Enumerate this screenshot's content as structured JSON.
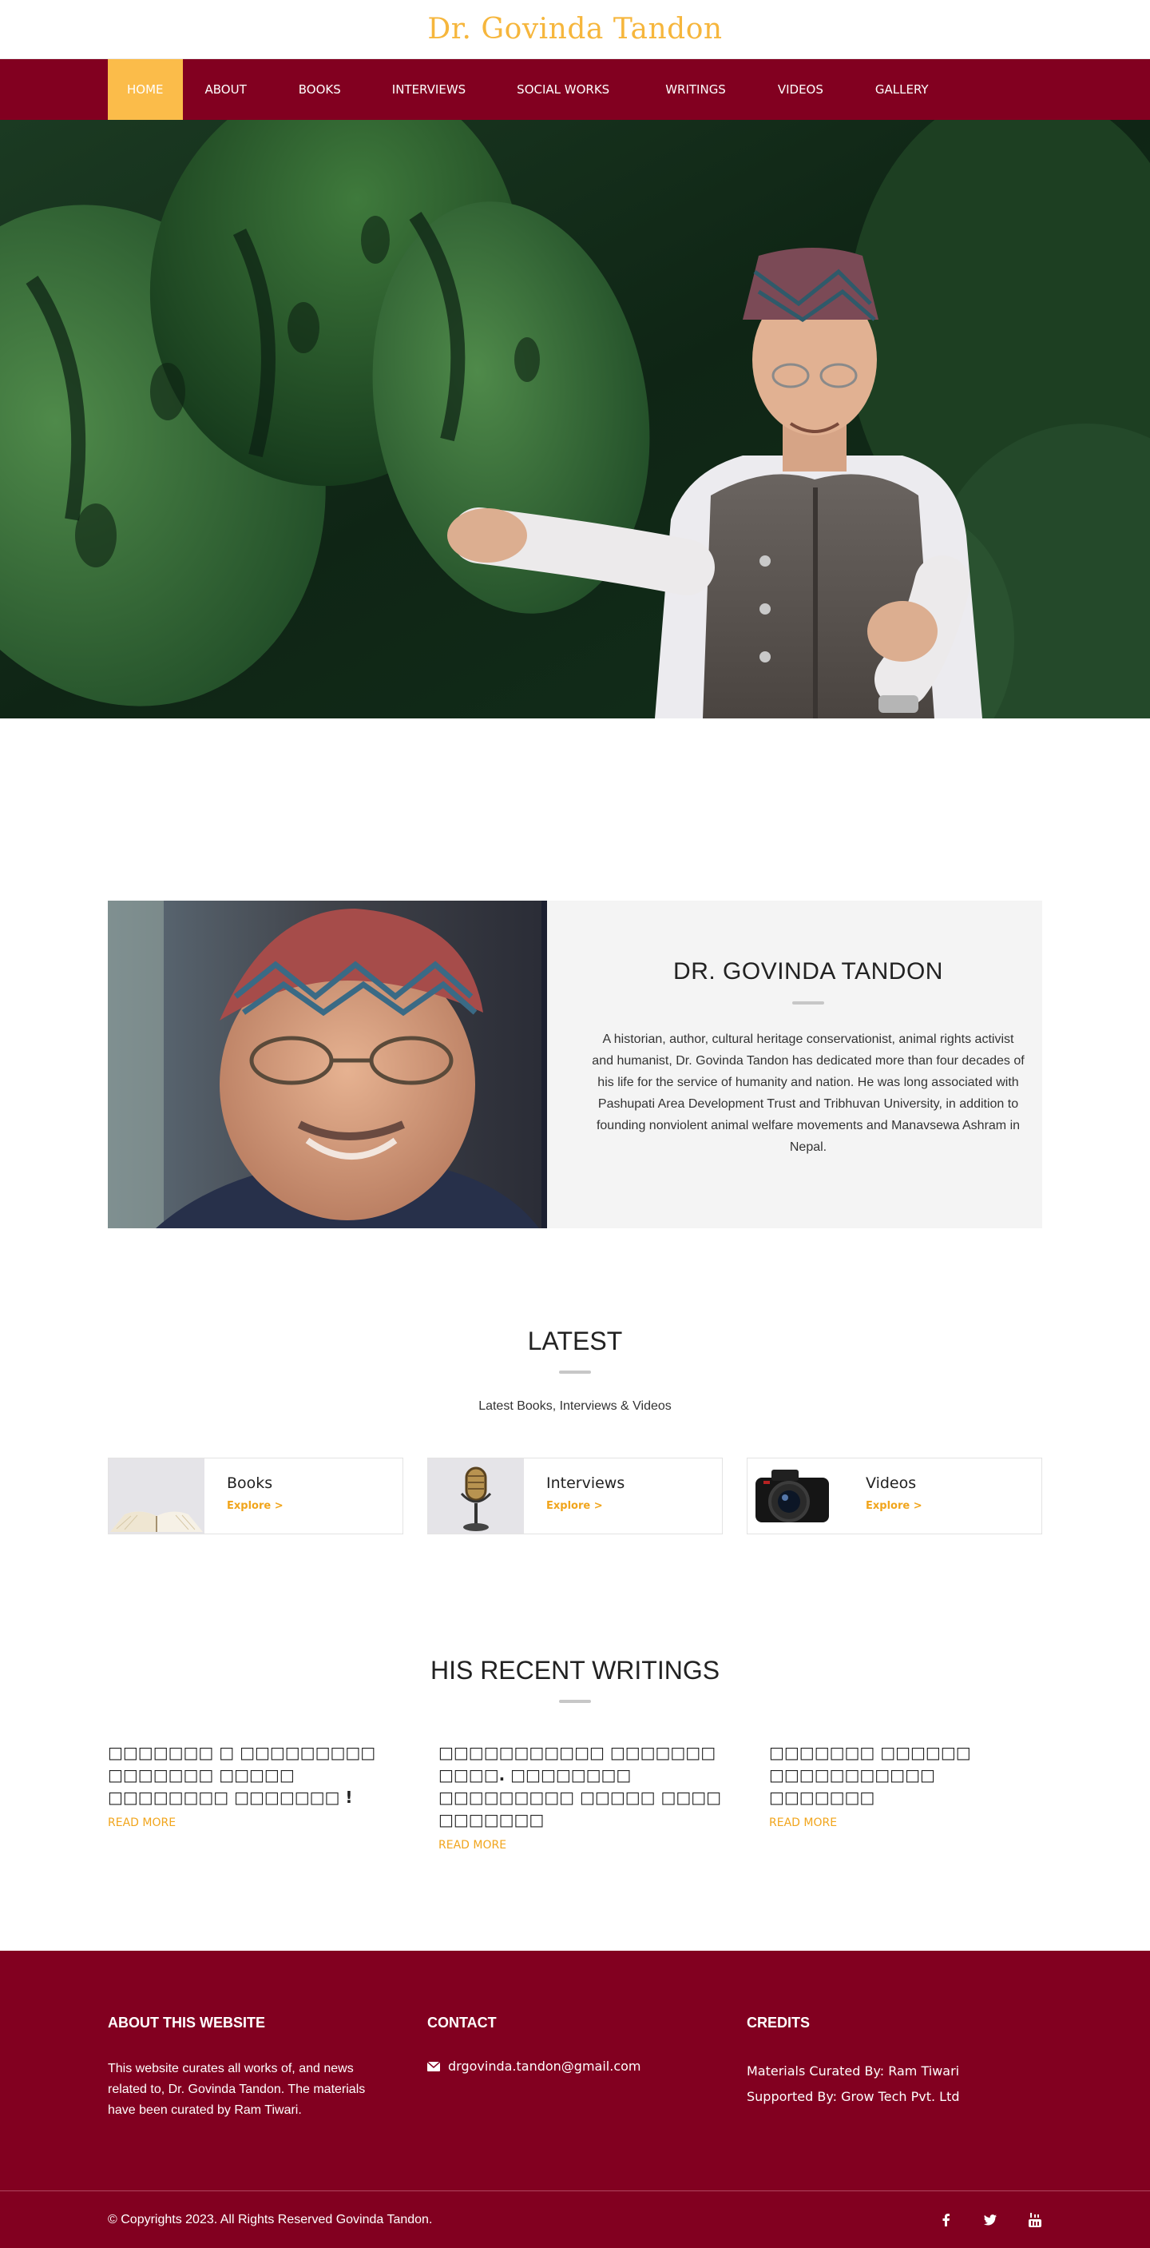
{
  "site": {
    "title": "Dr. Govinda Tandon"
  },
  "nav": {
    "items": [
      {
        "label": "HOME"
      },
      {
        "label": "ABOUT"
      },
      {
        "label": "BOOKS"
      },
      {
        "label": "INTERVIEWS"
      },
      {
        "label": "SOCIAL WORKS"
      },
      {
        "label": "WRITINGS"
      },
      {
        "label": "VIDEOS"
      },
      {
        "label": "GALLERY"
      }
    ],
    "active": "HOME",
    "colors": {
      "bar": "#820020",
      "active": "#fbbc4a"
    }
  },
  "profile": {
    "name": "DR. GOVINDA TANDON",
    "description": "A historian, author, cultural heritage conservationist, animal rights activist and humanist, Dr. Govinda Tandon has dedicated more than four decades of his life for the service of humanity and nation. He was long associated with Pashupati Area Development Trust and Tribhuvan University, in addition to founding nonviolent animal welfare movements and Manavsewa Ashram in Nepal."
  },
  "latest": {
    "title": "LATEST",
    "subtitle": "Latest Books, Interviews & Videos",
    "cards": [
      {
        "title": "Books",
        "link": "Explore >",
        "icon": "open-book-image"
      },
      {
        "title": "Interviews",
        "link": "Explore >",
        "icon": "microphone-image"
      },
      {
        "title": "Videos",
        "link": "Explore >",
        "icon": "camera-image"
      }
    ]
  },
  "writings": {
    "title": "HIS RECENT WRITINGS",
    "items": [
      {
        "title": "□□□□□□□ □ □□□□□□□□□ □□□□□□□ □□□□□ □□□□□□□□ □□□□□□□ !",
        "link": "READ MORE"
      },
      {
        "title": "□□□□□□□□□□□ □□□□□□□ □□□□. □□□□□□□□ □□□□□□□□□ □□□□□ □□□□ □□□□□□□",
        "link": "READ MORE"
      },
      {
        "title": "□□□□□□□ □□□□□□ □□□□□□□□□□□ □□□□□□□",
        "link": "READ MORE"
      }
    ]
  },
  "footer": {
    "about": {
      "heading": "ABOUT THIS WEBSITE",
      "text": "This website curates all works of, and news related to, Dr. Govinda Tandon. The materials have been curated by Ram Tiwari."
    },
    "contact": {
      "heading": "CONTACT",
      "email": "drgovinda.tandon@gmail.com",
      "icon": "envelope-icon"
    },
    "credits": {
      "heading": "CREDITS",
      "curated": "Materials Curated By: Ram Tiwari",
      "supported": "Supported By: Grow Tech Pvt. Ltd"
    },
    "copyright": "© Copyrights 2023. All Rights Reserved Govinda Tandon.",
    "social_icons": [
      "facebook-icon",
      "twitter-icon",
      "youtube-icon"
    ],
    "colors": {
      "background": "#820020",
      "accent": "#f1a51c"
    }
  }
}
